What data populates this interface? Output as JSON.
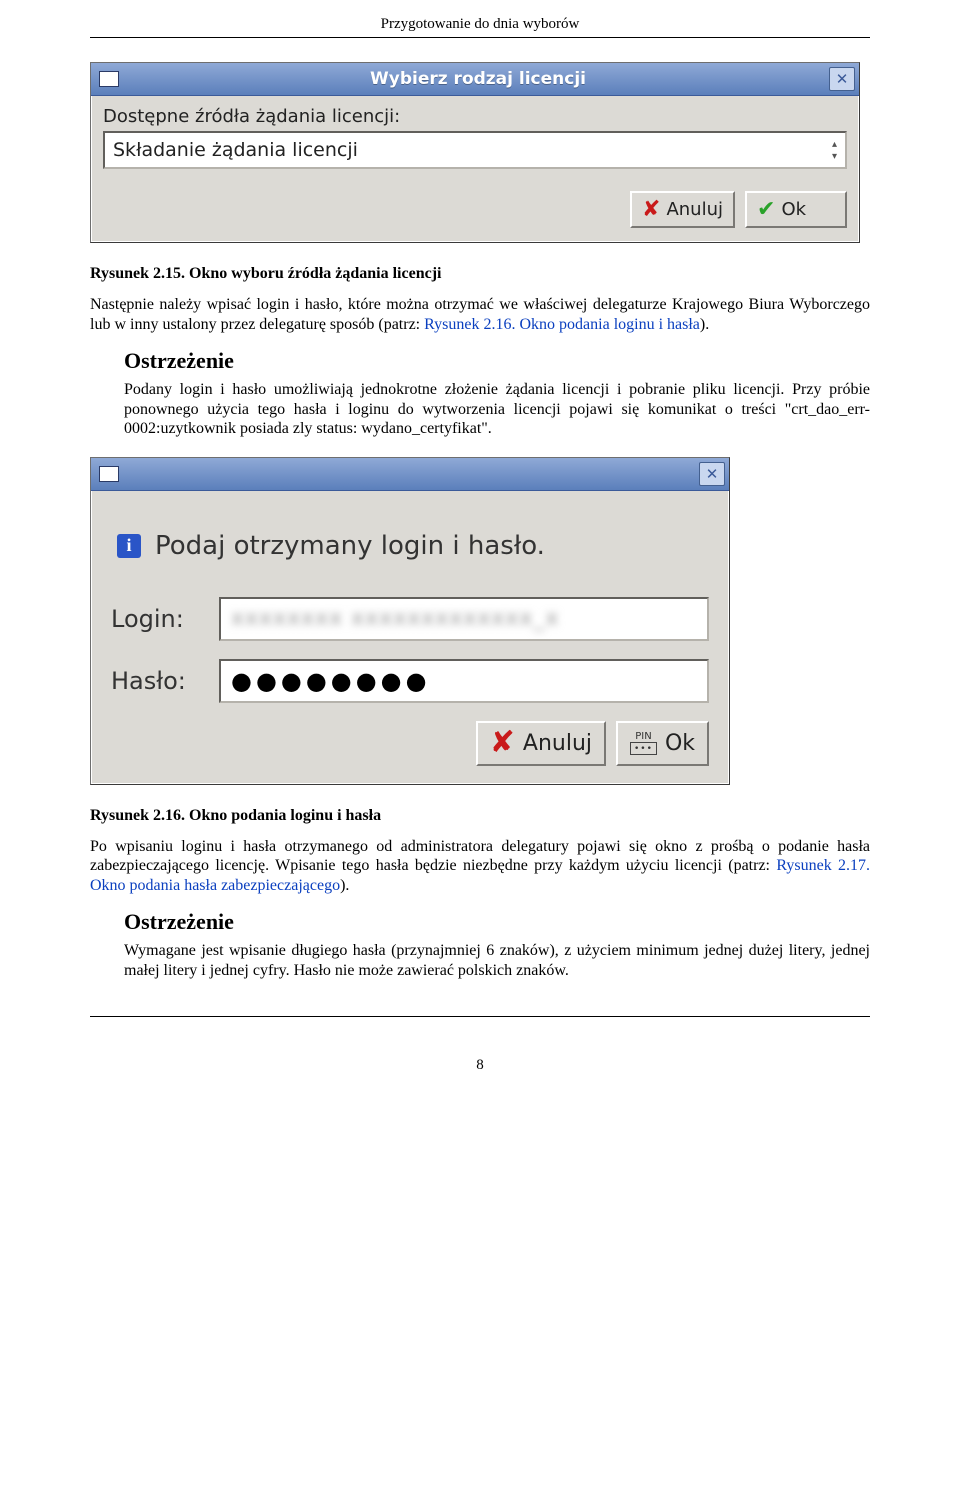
{
  "header": {
    "running_title": "Przygotowanie do dnia wyborów"
  },
  "dialog1": {
    "title": "Wybierz rodzaj licencji",
    "label": "Dostępne źródła żądania licencji:",
    "value": "Składanie żądania licencji",
    "cancel": "Anuluj",
    "ok": "Ok"
  },
  "caption1": "Rysunek 2.15. Okno wyboru źródła żądania licencji",
  "para1_pre": "Następnie należy wpisać login i hasło, które można otrzymać we właściwej delegaturze Krajowego Biura Wyborczego lub w inny ustalony przez delegaturę sposób (patrz: ",
  "para1_link": "Rysunek 2.16. Okno podania loginu i hasła",
  "para1_post": ").",
  "warn1": {
    "title": "Ostrzeżenie",
    "text": "Podany login i hasło umożliwiają jednokrotne złożenie żądania licencji i pobranie pliku licencji. Przy próbie ponownego użycia tego hasła i loginu do wytworzenia licencji pojawi się komunikat o treści \"crt_dao_err-0002:uzytkownik posiada zly status: wydano_certyfikat\"."
  },
  "dialog2": {
    "prompt": "Podaj otrzymany login i hasło.",
    "login_label": "Login:",
    "haslo_label": "Hasło:",
    "password_mask": "●●●●●●●●",
    "cancel": "Anuluj",
    "ok": "Ok",
    "pin_label": "PIN"
  },
  "caption2": "Rysunek 2.16. Okno podania loginu i hasła",
  "para2_pre": "Po wpisaniu loginu i hasła otrzymanego od administratora delegatury pojawi się okno z prośbą o podanie hasła zabezpieczającego licencję. Wpisanie tego hasła będzie niezbędne przy każdym użyciu licencji (patrz: ",
  "para2_link": "Rysunek 2.17. Okno podania hasła zabezpieczającego",
  "para2_post": ").",
  "warn2": {
    "title": "Ostrzeżenie",
    "text": "Wymagane jest wpisanie długiego hasła (przynajmniej 6 znaków), z użyciem minimum jednej dużej litery, jednej małej litery i jednej cyfry. Hasło nie może zawierać polskich znaków."
  },
  "footer": {
    "page": "8"
  }
}
